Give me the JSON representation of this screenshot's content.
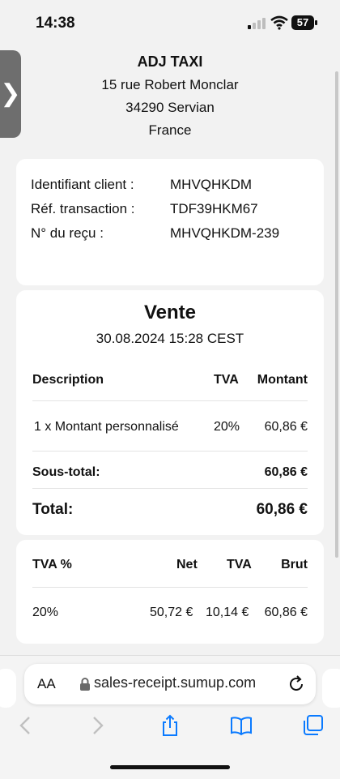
{
  "status_bar": {
    "time": "14:38",
    "battery": "57"
  },
  "merchant": {
    "name": "ADJ TAXI",
    "street": "15 rue Robert Monclar",
    "city": "34290 Servian",
    "country": "France"
  },
  "identifiers": [
    {
      "label": "Identifiant client :",
      "value": "MHVQHKDM"
    },
    {
      "label": "Réf. transaction :",
      "value": "TDF39HKM67"
    },
    {
      "label": "N° du reçu :",
      "value": "MHVQHKDM-239"
    }
  ],
  "sale": {
    "title": "Vente",
    "datetime": "30.08.2024 15:28 CEST",
    "headers": {
      "description": "Description",
      "vat": "TVA",
      "amount": "Montant"
    },
    "items": [
      {
        "description": "1 x Montant personnalisé",
        "vat": "20%",
        "amount": "60,86 €"
      }
    ],
    "subtotal_label": "Sous-total:",
    "subtotal_value": "60,86 €",
    "total_label": "Total:",
    "total_value": "60,86 €"
  },
  "vat_table": {
    "headers": {
      "rate": "TVA %",
      "net": "Net",
      "vat": "TVA",
      "gross": "Brut"
    },
    "rows": [
      {
        "rate": "20%",
        "net": "50,72 €",
        "vat": "10,14 €",
        "gross": "60,86 €"
      }
    ]
  },
  "browser": {
    "text_size_label": "AA",
    "url": "sales-receipt.sumup.com"
  },
  "icons": {
    "side_tab": "chevron-right-icon",
    "lock": "lock-icon",
    "reload": "reload-icon",
    "back": "back-arrow-icon",
    "forward": "forward-arrow-icon",
    "share": "share-icon",
    "bookmarks": "book-icon",
    "tabs": "tabs-icon"
  },
  "colors": {
    "accent": "#0a7aff",
    "text": "#111111",
    "background": "#f2f2f2"
  }
}
